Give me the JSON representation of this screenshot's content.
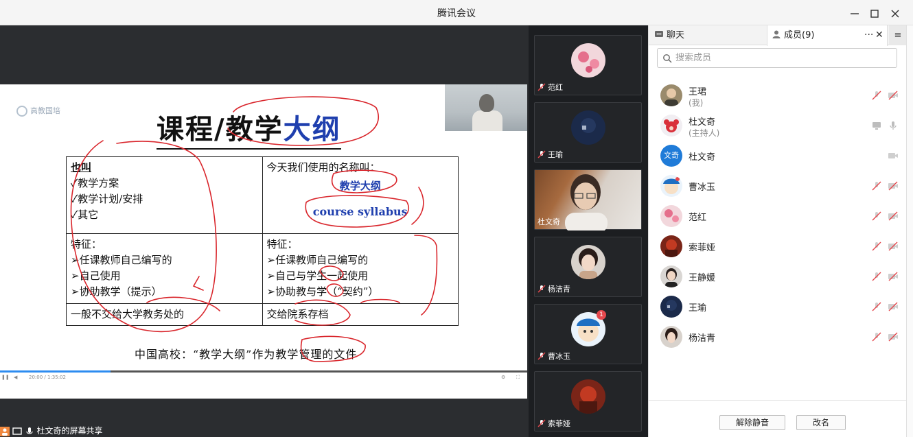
{
  "window": {
    "title": "腾讯会议"
  },
  "slide": {
    "logo_text": "高教国培",
    "title_part1": "课程/教学",
    "title_part2": "大纲",
    "cell_r1c1": [
      "也叫",
      "✓教学方案",
      "✓教学计划/安排",
      "✓其它"
    ],
    "cell_r1c2_intro": "今天我们使用的名称叫：",
    "cell_r1c2_term1": "教学大纲",
    "cell_r1c2_term2": "course syllabus",
    "cell_r2c1": [
      "特征：",
      "➢任课教师自己编写的",
      "➢自己使用",
      "➢协助教学（提示）"
    ],
    "cell_r2c2": [
      "特征：",
      "➢任课教师自己编写的",
      "➢自己与学生一起使用",
      "➢协助教与学（“契约”）"
    ],
    "cell_r3c1": "一般不交给大学教务处的",
    "cell_r3c2": "交给院系存档",
    "footer": "中国高校：“教学大纲”作为教学管理的文件"
  },
  "progress": {
    "fraction": 0.21,
    "time_text": "20:00 / 1:35:02"
  },
  "share_bar": {
    "label": "杜文奇的屏幕共享"
  },
  "thumbnails": [
    {
      "name": "范红",
      "kind": "avatar",
      "avatar": "flower-avatar"
    },
    {
      "name": "王瑜",
      "kind": "avatar",
      "avatar": "navy-avatar"
    },
    {
      "name": "杜文奇",
      "kind": "video"
    },
    {
      "name": "杨洁青",
      "kind": "avatar",
      "avatar": "girl-avatar"
    },
    {
      "name": "曹冰玉",
      "kind": "avatar",
      "avatar": "cartoon-avatar",
      "badge": "1"
    },
    {
      "name": "索菲娅",
      "kind": "avatar",
      "avatar": "red-avatar"
    }
  ],
  "panel": {
    "tab_chat": "聊天",
    "tab_members": "成员(9)",
    "more": "···",
    "close": "✕",
    "menu": "≡",
    "search_placeholder": "搜索成员",
    "members": [
      {
        "name": "王珺",
        "sub": "(我)",
        "avatar": "man-avatar",
        "mic": "mic-muted",
        "cam": "cam-off"
      },
      {
        "name": "杜文奇",
        "sub": "(主持人)",
        "avatar": "bear-avatar",
        "mic": "screen-share",
        "cam": "mic"
      },
      {
        "name": "杜文奇",
        "sub": "",
        "avatar": "text-avatar",
        "avatar_text": "文奇",
        "mic": "",
        "cam": "camera"
      },
      {
        "name": "曹冰玉",
        "sub": "",
        "avatar": "cartoon-avatar",
        "mic": "mic-muted",
        "cam": "cam-off"
      },
      {
        "name": "范红",
        "sub": "",
        "avatar": "flower-avatar",
        "mic": "mic-muted",
        "cam": "cam-off"
      },
      {
        "name": "索菲娅",
        "sub": "",
        "avatar": "red-avatar",
        "mic": "mic-muted",
        "cam": "cam-off"
      },
      {
        "name": "王静媛",
        "sub": "",
        "avatar": "woman-avatar",
        "mic": "mic-muted",
        "cam": "cam-off"
      },
      {
        "name": "王瑜",
        "sub": "",
        "avatar": "navy-avatar",
        "mic": "mic-muted",
        "cam": "cam-off"
      },
      {
        "name": "杨洁青",
        "sub": "",
        "avatar": "girl-avatar",
        "mic": "mic-muted",
        "cam": "cam-off"
      }
    ],
    "btn_unmute": "解除静音",
    "btn_rename": "改名"
  },
  "colors": {
    "accent": "#2d8cf0",
    "slide_blue": "#1f3fae",
    "annotation_red": "#d9262c",
    "mic_muted_red": "#e5484d"
  }
}
